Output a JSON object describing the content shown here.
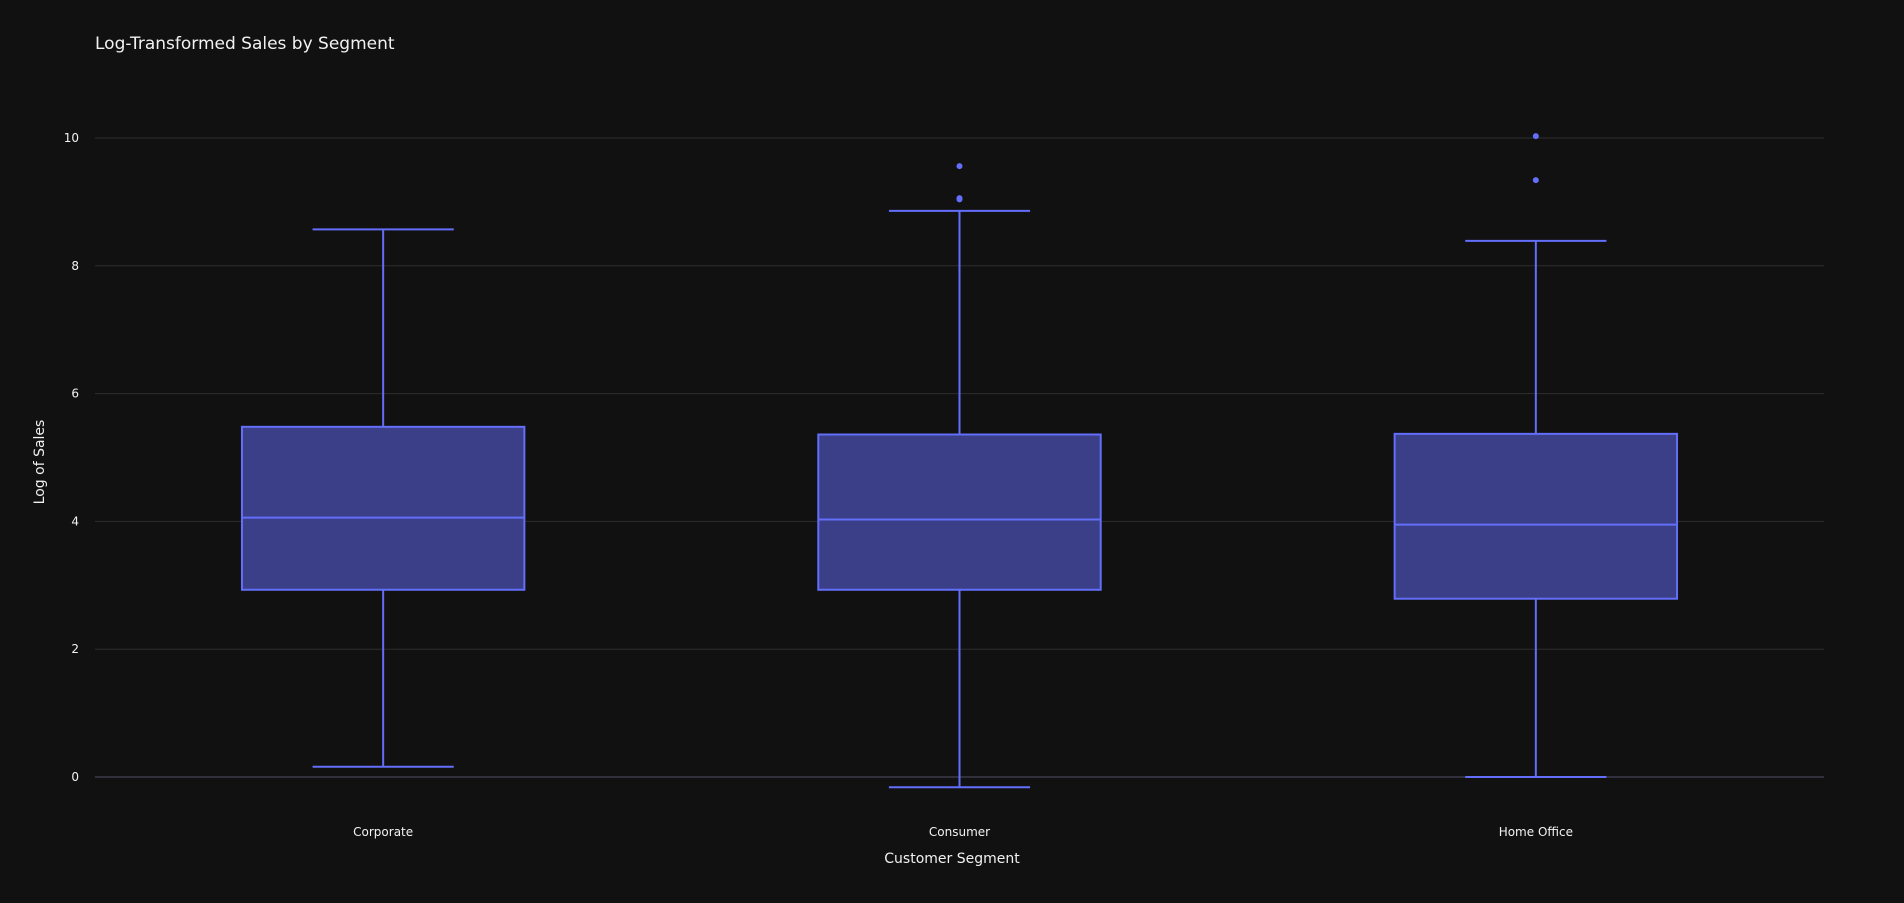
{
  "chart_data": {
    "type": "box",
    "title": "Log-Transformed Sales by Segment",
    "xlabel": "Customer Segment",
    "ylabel": "Log of Sales",
    "ylim": [
      -0.95,
      11.6
    ],
    "yticks": [
      0,
      2,
      4,
      6,
      8,
      10
    ],
    "grid": true,
    "categories": [
      "Corporate",
      "Consumer",
      "Home Office"
    ],
    "boxes": [
      {
        "name": "Corporate",
        "lowerfence": 0.16,
        "q1": 2.93,
        "median": 4.06,
        "q3": 5.48,
        "upperfence": 8.57,
        "outliers": []
      },
      {
        "name": "Consumer",
        "lowerfence": -0.16,
        "q1": 2.93,
        "median": 4.03,
        "q3": 5.36,
        "upperfence": 8.86,
        "outliers": [
          9.04,
          9.06,
          9.56
        ]
      },
      {
        "name": "Home Office",
        "lowerfence": 0.0,
        "q1": 2.79,
        "median": 3.95,
        "q3": 5.37,
        "upperfence": 8.39,
        "outliers": [
          9.34,
          10.03
        ]
      }
    ],
    "colors": {
      "line": "#636efa",
      "fill": "#3a3f87",
      "background": "#111111"
    }
  }
}
